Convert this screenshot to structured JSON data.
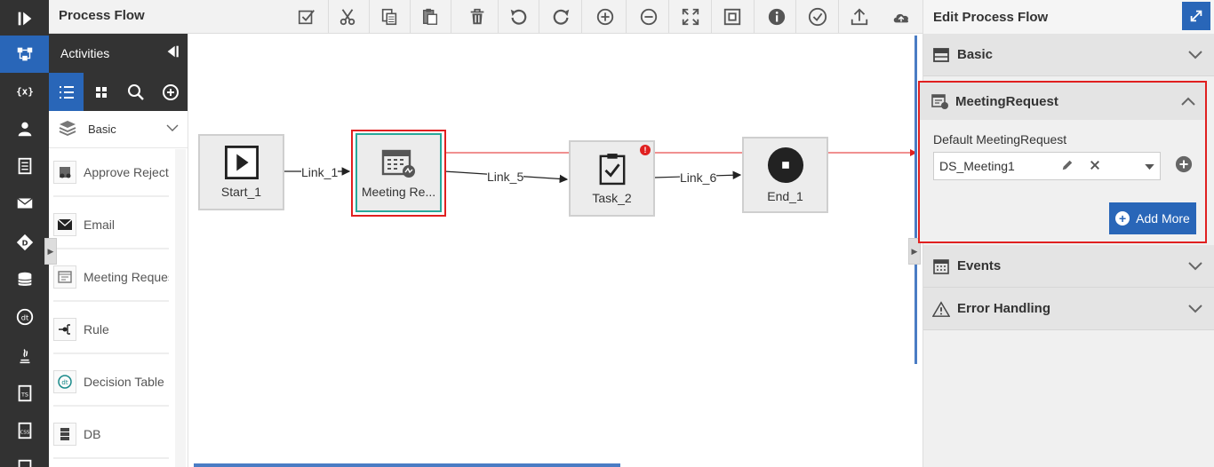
{
  "header": {
    "title": "Process Flow"
  },
  "toolbar": {
    "tools": [
      "validate-icon",
      "cut-icon",
      "copy-icon",
      "paste-icon",
      "delete-icon",
      "undo-icon",
      "redo-icon",
      "zoom-in-icon",
      "zoom-out-icon",
      "fit-screen-icon",
      "layout-icon",
      "info-icon",
      "check-icon",
      "upload-icon",
      "cloud-icon"
    ]
  },
  "rail": {
    "icons": [
      "process-icon",
      "variables-icon",
      "user-icon",
      "document-icon",
      "mail-icon",
      "decision-icon",
      "database-icon",
      "decision-table-icon",
      "java-icon",
      "script-icon",
      "css-icon",
      "file-icon"
    ]
  },
  "palette": {
    "title": "Activities",
    "category": "Basic",
    "items": [
      {
        "label": "Approve Reject",
        "icon": "approve-icon"
      },
      {
        "label": "Email",
        "icon": "email-icon"
      },
      {
        "label": "Meeting Reques",
        "icon": "meeting-icon"
      },
      {
        "label": "Rule",
        "icon": "rule-icon"
      },
      {
        "label": "Decision Table",
        "icon": "decision-table-icon"
      },
      {
        "label": "DB",
        "icon": "db-icon"
      }
    ]
  },
  "canvas": {
    "nodes": [
      {
        "id": "start",
        "label": "Start_1"
      },
      {
        "id": "meeting",
        "label": "Meeting Re..."
      },
      {
        "id": "task",
        "label": "Task_2"
      },
      {
        "id": "end",
        "label": "End_1"
      }
    ],
    "links": [
      "Link_1",
      "Link_5",
      "Link_6"
    ]
  },
  "panel": {
    "title": "Edit Process Flow",
    "sections": {
      "basic": "Basic",
      "meeting": "MeetingRequest",
      "events": "Events",
      "error": "Error Handling"
    },
    "meeting": {
      "field_label": "Default MeetingRequest",
      "value": "DS_Meeting1",
      "add_more": "Add More"
    }
  },
  "colors": {
    "accent": "#2966b8",
    "highlight": "#e02020",
    "selection": "#27a89a"
  }
}
